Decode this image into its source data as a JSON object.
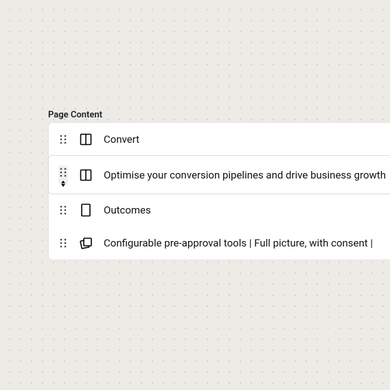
{
  "section": {
    "title": "Page Content"
  },
  "blocks": [
    {
      "icon": "columns-icon",
      "label": "Convert",
      "focused": false,
      "dragActive": false
    },
    {
      "icon": "columns-icon",
      "label": "Optimise your conversion pipelines and drive business growth",
      "focused": true,
      "dragActive": true
    },
    {
      "icon": "page-icon",
      "label": "Outcomes",
      "focused": false,
      "dragActive": false
    },
    {
      "icon": "cards-icon",
      "label": "Configurable pre-approval tools | Full picture, with consent |",
      "focused": false,
      "dragActive": false
    }
  ]
}
